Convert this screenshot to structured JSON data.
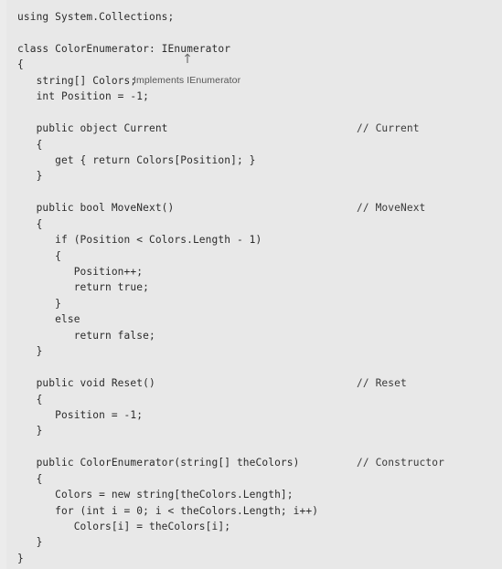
{
  "document": {
    "kind": "code-listing",
    "language": "C#",
    "background_color": "#e8e8e8",
    "text_color": "#2b2b2b",
    "comment_color": "#3a3a3a",
    "annotation_color": "#555555"
  },
  "annotation": {
    "text": "Implements IEnumerator",
    "pointer_icon": "up-arrow-icon",
    "pointer_glyph": "↑"
  },
  "code": {
    "lines": [
      {
        "text": "using System.Collections;",
        "comment": ""
      },
      {
        "text": "",
        "comment": ""
      },
      {
        "text": "class ColorEnumerator: IEnumerator",
        "comment": ""
      },
      {
        "text": "{",
        "comment": ""
      },
      {
        "text": "   string[] Colors;",
        "comment": "",
        "annotation": "Implements IEnumerator"
      },
      {
        "text": "   int Position = -1;",
        "comment": ""
      },
      {
        "text": "",
        "comment": ""
      },
      {
        "text": "   public object Current",
        "comment": "// Current"
      },
      {
        "text": "   {",
        "comment": ""
      },
      {
        "text": "      get { return Colors[Position]; }",
        "comment": ""
      },
      {
        "text": "   }",
        "comment": ""
      },
      {
        "text": "",
        "comment": ""
      },
      {
        "text": "   public bool MoveNext()",
        "comment": "// MoveNext"
      },
      {
        "text": "   {",
        "comment": ""
      },
      {
        "text": "      if (Position < Colors.Length - 1)",
        "comment": ""
      },
      {
        "text": "      {",
        "comment": ""
      },
      {
        "text": "         Position++;",
        "comment": ""
      },
      {
        "text": "         return true;",
        "comment": ""
      },
      {
        "text": "      }",
        "comment": ""
      },
      {
        "text": "      else",
        "comment": ""
      },
      {
        "text": "         return false;",
        "comment": ""
      },
      {
        "text": "   }",
        "comment": ""
      },
      {
        "text": "",
        "comment": ""
      },
      {
        "text": "   public void Reset()",
        "comment": "// Reset"
      },
      {
        "text": "   {",
        "comment": ""
      },
      {
        "text": "      Position = -1;",
        "comment": ""
      },
      {
        "text": "   }",
        "comment": ""
      },
      {
        "text": "",
        "comment": ""
      },
      {
        "text": "   public ColorEnumerator(string[] theColors)",
        "comment": "// Constructor"
      },
      {
        "text": "   {",
        "comment": ""
      },
      {
        "text": "      Colors = new string[theColors.Length];",
        "comment": ""
      },
      {
        "text": "      for (int i = 0; i < theColors.Length; i++)",
        "comment": ""
      },
      {
        "text": "         Colors[i] = theColors[i];",
        "comment": ""
      },
      {
        "text": "   }",
        "comment": ""
      },
      {
        "text": "}",
        "comment": ""
      }
    ]
  }
}
